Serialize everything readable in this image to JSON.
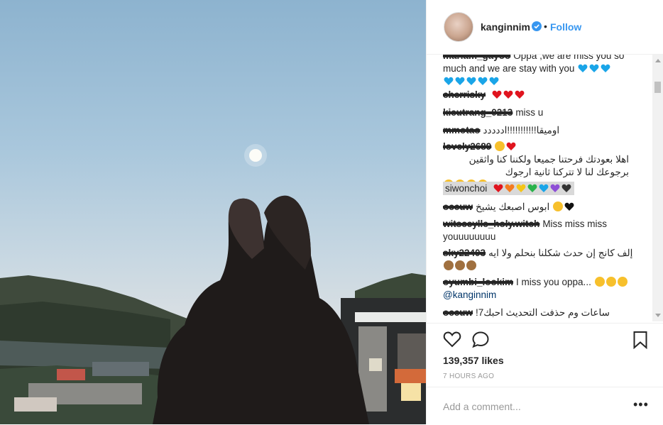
{
  "post": {
    "username": "kanginnim",
    "separator": "•",
    "follow_label": "Follow",
    "likes": "139,357 likes",
    "time_ago": "7 HOURS AGO",
    "add_comment_placeholder": "Add a comment...",
    "more_label": "•••"
  },
  "comments": [
    {
      "user": "mariam_gayoo",
      "text": "Oppa ,we are miss you so much and we are stay with you"
    },
    {
      "user": "cherrisky",
      "text": ""
    },
    {
      "user": "kieutrang_0213",
      "text": "miss u"
    },
    {
      "user": "mmotao",
      "text": "اوميقا!!!!!!!!!!!اددددد"
    },
    {
      "user": "lovely2689",
      "text": "اهلا بعودتك فرحتنا جميعا ولكننا كنا واثقين برجوعك لنا لا تتركنا ثانية ارجوك"
    },
    {
      "user": "siwonchoi",
      "text": ""
    },
    {
      "user": "occuw",
      "text": "ابوس اصبعك يشيخ"
    },
    {
      "user": "witsceylle_holy.witch",
      "text": "Miss miss miss youuuuuuuu"
    },
    {
      "user": "sky22403",
      "text": "إلف كانج إن حدث شكلنا بنحلم ولا ايه"
    },
    {
      "user": "oyumbi_lookim",
      "text": "I miss you oppa...",
      "mention": "@kanginnim"
    },
    {
      "user": "occuw",
      "text": "!ساعات وم حذفت التحديث احبك7"
    }
  ],
  "colors": {
    "link": "#3897f0",
    "text": "#262626",
    "muted": "#999999",
    "heart": "#ed4956"
  }
}
